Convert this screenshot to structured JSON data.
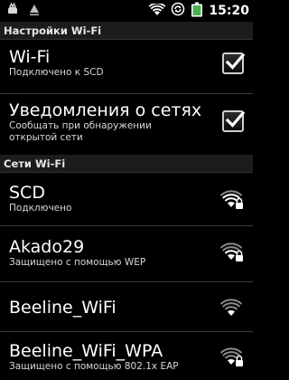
{
  "status_bar": {
    "time": "15:20",
    "left_icons": [
      "usb-debug-icon",
      "upload-icon"
    ],
    "right_icons": [
      "wifi-signal-icon",
      "sync-icon",
      "battery-icon"
    ],
    "battery_level": 0.9
  },
  "wifi_settings": {
    "section_title": "Настройки Wi-Fi",
    "items": [
      {
        "title": "Wi-Fi",
        "subtitle": "Подключено к SCD",
        "checked": true
      },
      {
        "title": "Уведомления о сетях",
        "subtitle_line1": "Сообщать при обнаружении",
        "subtitle_line2": "открытой сети",
        "checked": true
      }
    ]
  },
  "networks": {
    "section_title": "Сети Wi-Fi",
    "items": [
      {
        "name": "SCD",
        "status": "Подключено",
        "secured": true,
        "signal": 3
      },
      {
        "name": "Akado29",
        "status": "Защищено с помощью WEP",
        "secured": true,
        "signal": 2
      },
      {
        "name": "Beeline_WiFi",
        "status": "",
        "secured": false,
        "signal": 1
      },
      {
        "name": "Beeline_WiFi_WPA",
        "status": "Защищено с помощью 802.1x EAP",
        "secured": true,
        "signal": 1
      }
    ]
  },
  "colors": {
    "background": "#000000",
    "header_background": "#1c1c1c",
    "checkmark": "#ffffff",
    "battery": "#4caf50"
  }
}
